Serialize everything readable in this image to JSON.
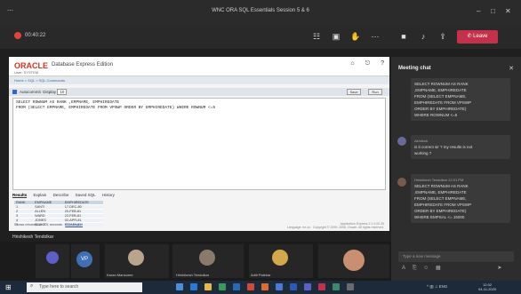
{
  "window": {
    "title": "WNC ORA SQL Essentials Session 5 & 6"
  },
  "call": {
    "timer": "00:40:22",
    "leave_label": "Leave"
  },
  "oracle": {
    "brand": "ORACLE",
    "product": "Database Express Edition",
    "user": "User: SYSTEM",
    "crumbs": "Home > SQL > SQL Commands",
    "autocommit": "Autocommit",
    "display_label": "Display",
    "display_value": "10",
    "save_label": "Save",
    "run_label": "Run",
    "sql_lines": [
      "SELECT ROWNUM AS RANK ,EMPNAME, EMPHIREDATE",
      "FROM (SELECT EMPNAME, EMPHIREDATE FROM VPSWP ORDER BY EMPHIREDATE) WHERE ROWNUM <=5"
    ],
    "tabs": [
      "Results",
      "Explain",
      "Describe",
      "Saved SQL",
      "History"
    ],
    "result_headers": [
      "RANK",
      "EMPNAME",
      "EMPHIREDATE"
    ],
    "result_rows": [
      [
        "1",
        "SANTI",
        "17-DEC-80"
      ],
      [
        "2",
        "ALLEN",
        "20-FEB-81"
      ],
      [
        "3",
        "WARD",
        "22-FEB-81"
      ],
      [
        "4",
        "JONES",
        "02-APR-81"
      ],
      [
        "5",
        "BLAKE",
        "01-MAY-81"
      ]
    ],
    "rows_msg": "5 rows returned in 0.01 seconds",
    "csv_link": "CSV Export",
    "footer_lang": "Language: en-us",
    "footer_copy": "Copyright © 1999, 2006, Oracle. All rights reserved.",
    "footer_ver": "Application Express 2.1.0.00.39"
  },
  "presenter": {
    "name": "Hrishikesh Tendolkar"
  },
  "participants": [
    {
      "initials": "",
      "name": ""
    },
    {
      "initials": "VP",
      "name": ""
    },
    {
      "initials": "",
      "name": "Karan Mansuree"
    },
    {
      "initials": "",
      "name": "Hrishikesh Tendolkar"
    },
    {
      "initials": "",
      "name": "Aditi Palekar"
    },
    {
      "initials": "",
      "name": ""
    }
  ],
  "chat": {
    "title": "Meeting chat",
    "messages": [
      {
        "sender": "",
        "lines": [
          "SELECT ROWNUM AS RANK",
          ",EMPNAME, EMPHIREDATE",
          "FROM (SELECT EMPNAME,",
          "EMPHIREDATE FROM VPSWP",
          "ORDER BY EMPHIREDATE)",
          "WHERE ROWNUM <=5"
        ]
      },
      {
        "sender": "Akhilesh",
        "lines": [
          "is it correct sir ? my results is not",
          "working ?"
        ]
      },
      {
        "sender": "Hrishikesh Tendolkar  12:01 PM",
        "lines": [
          "SELECT ROWNUM AS RANK",
          ",EMPNAME, EMPHIREDATE",
          "FROM (SELECT EMPNAME,",
          "EMPHIREDATE FROM VPSWP",
          "ORDER BY EMPHIREDATE)",
          "WHERE EMPSAL <= 15000"
        ]
      }
    ],
    "compose_placeholder": "Type a new message"
  },
  "taskbar": {
    "search_placeholder": "Type here to search",
    "tray_lang": "ENG",
    "time": "12:02",
    "date": "04-11-2020"
  }
}
